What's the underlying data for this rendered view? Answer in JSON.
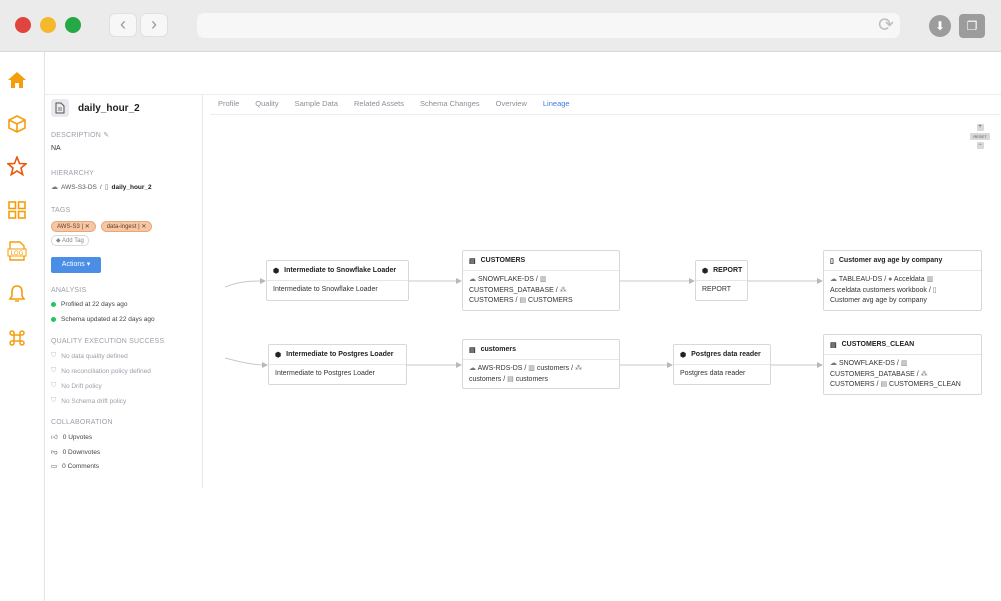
{
  "asset": {
    "name": "daily_hour_2"
  },
  "description": {
    "title": "DESCRIPTION",
    "value": "NA"
  },
  "hierarchy": {
    "title": "HIERARCHY",
    "source": "AWS-S3-DS",
    "sep": "/",
    "asset": "daily_hour_2"
  },
  "tags": {
    "title": "TAGS",
    "items": [
      {
        "label": "AWS-S3"
      },
      {
        "label": "data-ingest"
      }
    ],
    "add_label": "Add Tag"
  },
  "actions": {
    "label": "Actions"
  },
  "analysis": {
    "title": "ANALYSIS",
    "items": [
      "Profiled at 22 days ago",
      "Schema updated at 22 days ago"
    ]
  },
  "quality": {
    "title": "QUALITY EXECUTION SUCCESS",
    "items": [
      "No data quality defined",
      "No reconciliation policy defined",
      "No Drift policy",
      "No Schema drift policy"
    ]
  },
  "collaboration": {
    "title": "COLLABORATION",
    "upvotes": "0 Upvotes",
    "downvotes": "0 Downvotes",
    "comments": "0 Comments"
  },
  "tabs": [
    "Profile",
    "Quality",
    "Sample Data",
    "Related Assets",
    "Schema Changes",
    "Overview",
    "Lineage"
  ],
  "zoom": {
    "reset": "RESET"
  },
  "lineage": {
    "n1": {
      "title": "Intermediate to Snowflake Loader",
      "body": "Intermediate to Snowflake Loader"
    },
    "n2": {
      "title": "CUSTOMERS",
      "l1a": "SNOWFLAKE-DS /",
      "l2a": "CUSTOMERS_DATABASE /",
      "l3a": "CUSTOMERS /",
      "l3b": "CUSTOMERS"
    },
    "n3": {
      "title": "REPORT",
      "body": "REPORT"
    },
    "n4": {
      "title": "Customer avg age by company",
      "l1a": "TABLEAU-DS /",
      "l1b": "Acceldata",
      "l2a": "Acceldata customers workbook /",
      "l3a": "Customer avg age by company"
    },
    "n5": {
      "title": "Intermediate to Postgres Loader",
      "body": "Intermediate to Postgres Loader"
    },
    "n6": {
      "title": "customers",
      "l1a": "AWS-RDS-DS /",
      "l1b": "customers /",
      "l2a": "customers /",
      "l2b": "customers"
    },
    "n7": {
      "title": "Postgres data reader",
      "body": "Postgres data reader"
    },
    "n8": {
      "title": "CUSTOMERS_CLEAN",
      "l1a": "SNOWFLAKE-DS /",
      "l2a": "CUSTOMERS_DATABASE /",
      "l3a": "CUSTOMERS /",
      "l3b": "CUSTOMERS_CLEAN"
    }
  },
  "colors": {
    "accent": "#3b7ddd",
    "rail_icon": "#f59e0b",
    "tag_bg": "#f5c7a6",
    "ok": "#22c55e"
  }
}
